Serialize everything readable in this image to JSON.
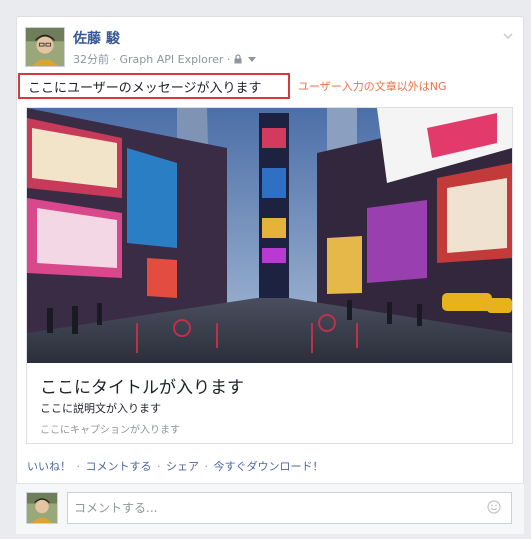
{
  "post": {
    "author": "佐藤 駿",
    "meta_text": "32分前 · Graph API Explorer ·",
    "message": "ここにユーザーのメッセージが入ります",
    "annotation": "ユーザー入力の文章以外はNG"
  },
  "link_preview": {
    "title": "ここにタイトルが入ります",
    "description": "ここに説明文が入ります",
    "caption": "ここにキャプションが入ります"
  },
  "actions": {
    "like": "いいね！",
    "comment": "コメントする",
    "share": "シェア",
    "download": "今すぐダウンロード！",
    "sep": "·"
  },
  "comment": {
    "placeholder": "コメントする..."
  },
  "icons": {
    "privacy": "lock-icon",
    "dropdown": "caret-down-icon",
    "options": "chevron-down-icon",
    "emoji": "smiley-icon"
  }
}
